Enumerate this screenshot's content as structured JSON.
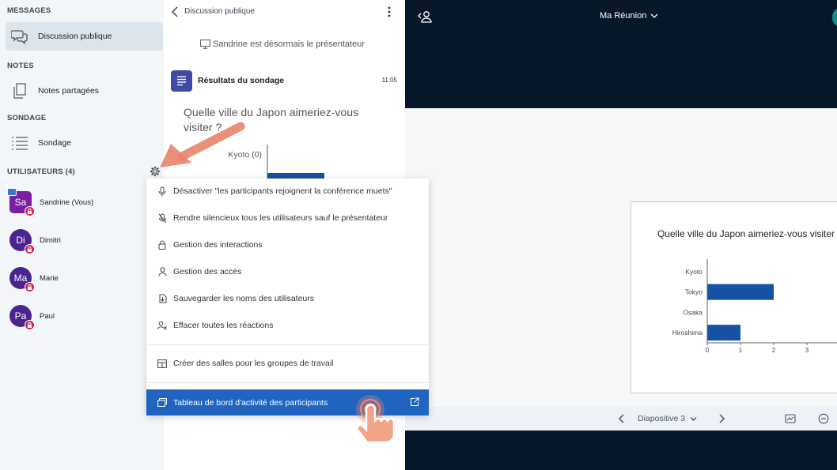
{
  "sidebar": {
    "sections": {
      "messages": "MESSAGES",
      "notes": "NOTES",
      "poll": "SONDAGE",
      "users": "UTILISATEURS (4)"
    },
    "items": {
      "public_chat": "Discussion publique",
      "shared_notes": "Notes partagées",
      "poll": "Sondage"
    },
    "users": [
      {
        "initials": "Sa",
        "name": "Sandrine (Vous)",
        "color": "#7a1fa2"
      },
      {
        "initials": "Di",
        "name": "Dimitri",
        "color": "#4a2590"
      },
      {
        "initials": "Ma",
        "name": "Marie",
        "color": "#4a2590"
      },
      {
        "initials": "Pa",
        "name": "Paul",
        "color": "#4a2590"
      }
    ]
  },
  "chat": {
    "title": "Discussion publique",
    "system_message": "Sandrine est désormais le présentateur",
    "poll_result_title": "Résultats du sondage",
    "poll_result_time": "11:05",
    "poll_question": "Quelle ville du Japon aimeriez-vous visiter ?",
    "mini_chart_label": "Kyoto (0)"
  },
  "presentation": {
    "meeting_title": "Ma Réunion",
    "slide_label": "Diapositive 3"
  },
  "menu": {
    "items": [
      "Désactiver \"les participants rejoignent la conférence muets\"",
      "Rendre silencieux tous les utilisateurs sauf le présentateur",
      "Gestion des interactions",
      "Gestion des accès",
      "Sauvegarder les noms des utilisateurs",
      "Effacer toutes les réactions",
      "Créer des salles pour les groupes de travail",
      "Tableau de bord d'activité des participants"
    ]
  },
  "colors": {
    "accent": "#1f65c0",
    "dark_bg": "#06172a",
    "bar": "#1552a3",
    "tutorial_arrow": "#e8836a"
  },
  "chart_data": {
    "type": "bar",
    "orientation": "horizontal",
    "title": "Quelle ville du Japon aimeriez-vous visiter ?",
    "categories": [
      "Kyoto",
      "Tokyo",
      "Osaka",
      "Hiroshima"
    ],
    "values": [
      0,
      2,
      0,
      1
    ],
    "x_ticks": [
      "0",
      "1",
      "2",
      "3"
    ],
    "xlim": [
      0,
      3
    ]
  }
}
